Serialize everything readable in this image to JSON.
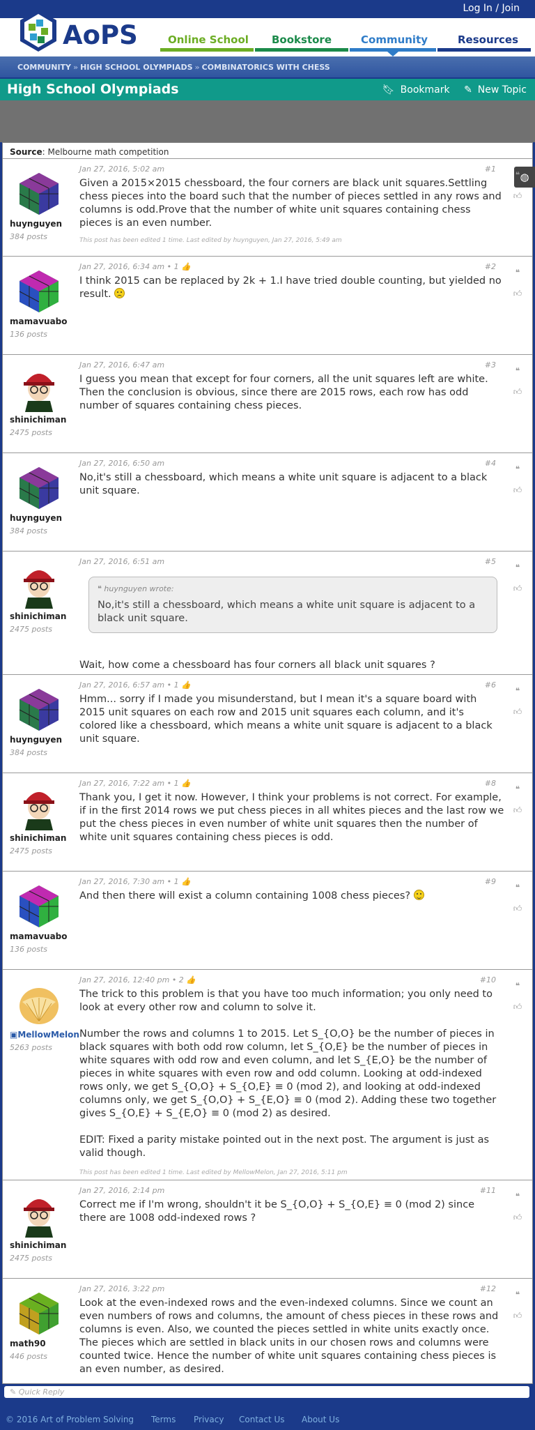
{
  "topbar": {
    "login": "Log In / Join"
  },
  "logo": {
    "text": "AoPS"
  },
  "nav": [
    {
      "label": "Online School",
      "color": "#6cad24"
    },
    {
      "label": "Bookstore",
      "color": "#1b8a4a"
    },
    {
      "label": "Community",
      "color": "#2f7cc8"
    },
    {
      "label": "Resources",
      "color": "#1b3a8a"
    }
  ],
  "breadcrumb": [
    "COMMUNITY",
    "HIGH SCHOOL OLYMPIADS",
    "COMBINATORICS WITH CHESS"
  ],
  "forum": {
    "title": "High School Olympiads",
    "bookmark": "Bookmark",
    "new_topic": "New Topic"
  },
  "source": {
    "label": "Source",
    "value": ": Melbourne math competition"
  },
  "posts": [
    {
      "user": "huynguyen",
      "count": "384 posts",
      "date": "Jan 27, 2016, 5:02 am",
      "num": "#1",
      "body": [
        "Given a 2015×2015 chessboard, the four corners are black unit squares.Settling chess pieces into the board such that the number of pieces settled in any rows and columns is odd.Prove that the number of white unit squares containing chess pieces is an even number."
      ],
      "edited": "This post has been edited 1 time. Last edited by huynguyen, Jan 27, 2016, 5:49 am"
    },
    {
      "user": "mamavuabo",
      "count": "136 posts",
      "date": "Jan 27, 2016, 6:34 am • 1 👍",
      "num": "#2",
      "body": [
        "I think 2015 can be replaced by 2k + 1.I have tried double counting, but yielded no result."
      ]
    },
    {
      "user": "shinichiman",
      "count": "2475 posts",
      "date": "Jan 27, 2016, 6:47 am",
      "num": "#3",
      "body": [
        "I guess you mean that except for four corners, all the unit squares left are white. Then the conclusion is obvious, since there are 2015 rows, each row has odd number of squares containing chess pieces."
      ]
    },
    {
      "user": "huynguyen",
      "count": "384 posts",
      "date": "Jan 27, 2016, 6:50 am",
      "num": "#4",
      "body": [
        "No,it's still a chessboard, which means a white unit square is adjacent to a black unit square."
      ]
    },
    {
      "user": "shinichiman",
      "count": "2475 posts",
      "date": "Jan 27, 2016, 6:51 am",
      "num": "#5",
      "quote_head": "huynguyen wrote:",
      "quote_body": "No,it's still a chessboard, which means a white unit square is adjacent to a black unit square.",
      "body": [
        "Wait, how come a chessboard has four corners all black unit squares ?"
      ]
    },
    {
      "user": "huynguyen",
      "count": "384 posts",
      "date": "Jan 27, 2016, 6:57 am • 1 👍",
      "num": "#6",
      "body": [
        "Hmm... sorry if I made you misunderstand, but I mean it's a square board with 2015 unit squares on each row and 2015 unit squares each column, and it's colored like a chessboard, which means a white unit square is adjacent to a black unit square."
      ]
    },
    {
      "user": "shinichiman",
      "count": "2475 posts",
      "date": "Jan 27, 2016, 7:22 am • 1 👍",
      "num": "#8",
      "body": [
        "Thank you, I get it now. However, I think your problems is not correct. For example, if in the first 2014 rows we put chess pieces in all whites pieces and the last row we put the chess pieces in even number of white unit squares then the number of white unit squares containing chess pieces is odd."
      ]
    },
    {
      "user": "mamavuabo",
      "count": "136 posts",
      "date": "Jan 27, 2016, 7:30 am • 1 👍",
      "num": "#9",
      "body": [
        "And then there will exist a column containing 1008 chess pieces?"
      ]
    },
    {
      "user": "MellowMelon",
      "count": "5263 posts",
      "date": "Jan 27, 2016, 12:40 pm • 2 👍",
      "num": "#10",
      "body": [
        "The trick to this problem is that you have too much information; you only need to look at every other row and column to solve it.",
        "Number the rows and columns 1 to 2015. Let S_{O,O} be the number of pieces in black squares with both odd row column, let S_{O,E} be the number of pieces in white squares with odd row and even column, and let S_{E,O} be the number of pieces in white squares with even row and odd column. Looking at odd-indexed rows only, we get S_{O,O} + S_{O,E} ≡ 0 (mod 2), and looking at odd-indexed columns only, we get S_{O,O} + S_{E,O} ≡ 0 (mod 2). Adding these two together gives S_{O,E} + S_{E,O} ≡ 0 (mod 2) as desired.",
        "EDIT: Fixed a parity mistake pointed out in the next post. The argument is just as valid though."
      ],
      "edited": "This post has been edited 1 time. Last edited by MellowMelon, Jan 27, 2016, 5:11 pm"
    },
    {
      "user": "shinichiman",
      "count": "2475 posts",
      "date": "Jan 27, 2016, 2:14 pm",
      "num": "#11",
      "body": [
        "Correct me if I'm wrong, shouldn't it be S_{O,O} + S_{O,E} ≡ 0 (mod 2) since there are 1008 odd-indexed rows ?"
      ]
    },
    {
      "user": "math90",
      "count": "446 posts",
      "date": "Jan 27, 2016, 3:22 pm",
      "num": "#12",
      "body": [
        "Look at the even-indexed rows and the even-indexed columns. Since we count an even numbers of rows and columns, the amount of chess pieces in these rows and columns is even. Also, we counted the pieces settled in white units exactly once. The pieces which are settled in black units in our chosen rows and columns were counted twice. Hence the number of white unit squares containing chess pieces is an even number, as desired."
      ]
    }
  ],
  "quick_reply": {
    "placeholder": "Quick Reply"
  },
  "footer": [
    "© 2016 Art of Problem Solving",
    "Terms",
    "Privacy",
    "Contact Us",
    "About Us"
  ]
}
